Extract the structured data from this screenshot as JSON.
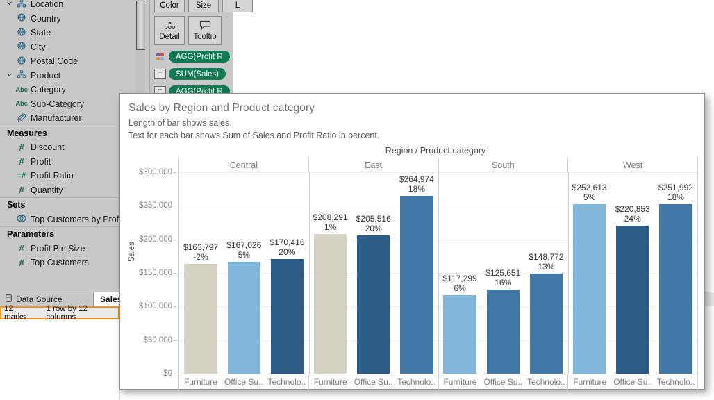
{
  "sidebar": {
    "groups": [
      {
        "type": "folder",
        "icon": "hierarchy-icon",
        "label": "Location",
        "caret": "⌄",
        "items": [
          {
            "icon": "globe-icon",
            "label": "Country"
          },
          {
            "icon": "globe-icon",
            "label": "State"
          },
          {
            "icon": "globe-icon",
            "label": "City"
          },
          {
            "icon": "globe-icon",
            "label": "Postal Code"
          }
        ]
      },
      {
        "type": "folder",
        "icon": "hierarchy-icon",
        "label": "Product",
        "caret": "⌄",
        "items": [
          {
            "icon": "abc-icon",
            "label": "Category"
          },
          {
            "icon": "abc-icon",
            "label": "Sub-Category"
          },
          {
            "icon": "paperclip-icon",
            "label": "Manufacturer"
          }
        ]
      }
    ],
    "sections": [
      {
        "title": "Measures",
        "items": [
          {
            "icon": "number-icon",
            "label": "Discount"
          },
          {
            "icon": "number-icon",
            "label": "Profit"
          },
          {
            "icon": "calculated-number-icon",
            "label": "Profit Ratio"
          },
          {
            "icon": "number-icon",
            "label": "Quantity"
          }
        ]
      },
      {
        "title": "Sets",
        "items": [
          {
            "icon": "set-icon",
            "label": "Top Customers by Profit"
          }
        ]
      },
      {
        "title": "Parameters",
        "items": [
          {
            "icon": "number-icon",
            "label": "Profit Bin Size"
          },
          {
            "icon": "number-icon",
            "label": "Top Customers"
          }
        ]
      }
    ]
  },
  "marks_card": {
    "buttons": [
      {
        "label": "Color",
        "icon": "color-icon"
      },
      {
        "label": "Size",
        "icon": "size-icon"
      },
      {
        "label": "L",
        "icon": "label-icon"
      },
      {
        "label": "Detail",
        "icon": "detail-icon"
      },
      {
        "label": "Tooltip",
        "icon": "tooltip-icon"
      }
    ],
    "pills": [
      {
        "icon": "color-dots-icon",
        "label": "AGG(Profit R"
      },
      {
        "icon": "text-icon",
        "label": "SUM(Sales)"
      },
      {
        "icon": "text-icon",
        "label": "AGG(Profit R"
      }
    ],
    "pill_color": "#0f7b52"
  },
  "bottom": {
    "data_source_tab": "Data Source",
    "data_source_icon": "database-icon",
    "sheet_tab": "Sales",
    "status_marks": "12 marks",
    "status_size": "1 row by 12 columns",
    "status_highlight_color": "#f2941e"
  },
  "viz": {
    "title": "Sales by Region and Product category",
    "subtitle1": "Length of bar shows sales.",
    "subtitle2": "Text for each bar shows Sum of Sales and Profit Ratio in percent."
  },
  "chart_data": {
    "type": "bar",
    "title": "Sales by Region and Product category",
    "column_title": "Region / Product category",
    "ylabel": "Sales",
    "xlabel": "",
    "ylim": [
      0,
      300000
    ],
    "yticks": [
      "$0",
      "$50,000",
      "$100,000",
      "$150,000",
      "$200,000",
      "$250,000",
      "$300,000"
    ],
    "ytick_values": [
      0,
      50000,
      100000,
      150000,
      200000,
      250000,
      300000
    ],
    "grid": true,
    "legend": "none",
    "regions": [
      "Central",
      "East",
      "South",
      "West"
    ],
    "categories": [
      "Furniture",
      "Office Su..",
      "Technolo.."
    ],
    "bars": [
      {
        "region": "Central",
        "category": "Furniture",
        "sales": 163797,
        "sales_label": "$163,797",
        "profit_ratio_label": "-2%",
        "color": "#d5d2c4"
      },
      {
        "region": "Central",
        "category": "Office Su..",
        "sales": 167026,
        "sales_label": "$167,026",
        "profit_ratio_label": "5%",
        "color": "#81b7dd"
      },
      {
        "region": "Central",
        "category": "Technolo..",
        "sales": 170416,
        "sales_label": "$170,416",
        "profit_ratio_label": "20%",
        "color": "#2b5d88"
      },
      {
        "region": "East",
        "category": "Furniture",
        "sales": 208291,
        "sales_label": "$208,291",
        "profit_ratio_label": "1%",
        "color": "#d5d2c4"
      },
      {
        "region": "East",
        "category": "Office Su..",
        "sales": 205516,
        "sales_label": "$205,516",
        "profit_ratio_label": "20%",
        "color": "#2b5d88"
      },
      {
        "region": "East",
        "category": "Technolo..",
        "sales": 264974,
        "sales_label": "$264,974",
        "profit_ratio_label": "18%",
        "color": "#4278a7"
      },
      {
        "region": "South",
        "category": "Furniture",
        "sales": 117299,
        "sales_label": "$117,299",
        "profit_ratio_label": "6%",
        "color": "#81b7dd"
      },
      {
        "region": "South",
        "category": "Office Su..",
        "sales": 125651,
        "sales_label": "$125,651",
        "profit_ratio_label": "16%",
        "color": "#4278a7"
      },
      {
        "region": "South",
        "category": "Technolo..",
        "sales": 148772,
        "sales_label": "$148,772",
        "profit_ratio_label": "13%",
        "color": "#4278a7"
      },
      {
        "region": "West",
        "category": "Furniture",
        "sales": 252613,
        "sales_label": "$252,613",
        "profit_ratio_label": "5%",
        "color": "#81b7dd"
      },
      {
        "region": "West",
        "category": "Office Su..",
        "sales": 220853,
        "sales_label": "$220,853",
        "profit_ratio_label": "24%",
        "color": "#2b5d88"
      },
      {
        "region": "West",
        "category": "Technolo..",
        "sales": 251992,
        "sales_label": "$251,992",
        "profit_ratio_label": "18%",
        "color": "#4278a7"
      }
    ]
  }
}
